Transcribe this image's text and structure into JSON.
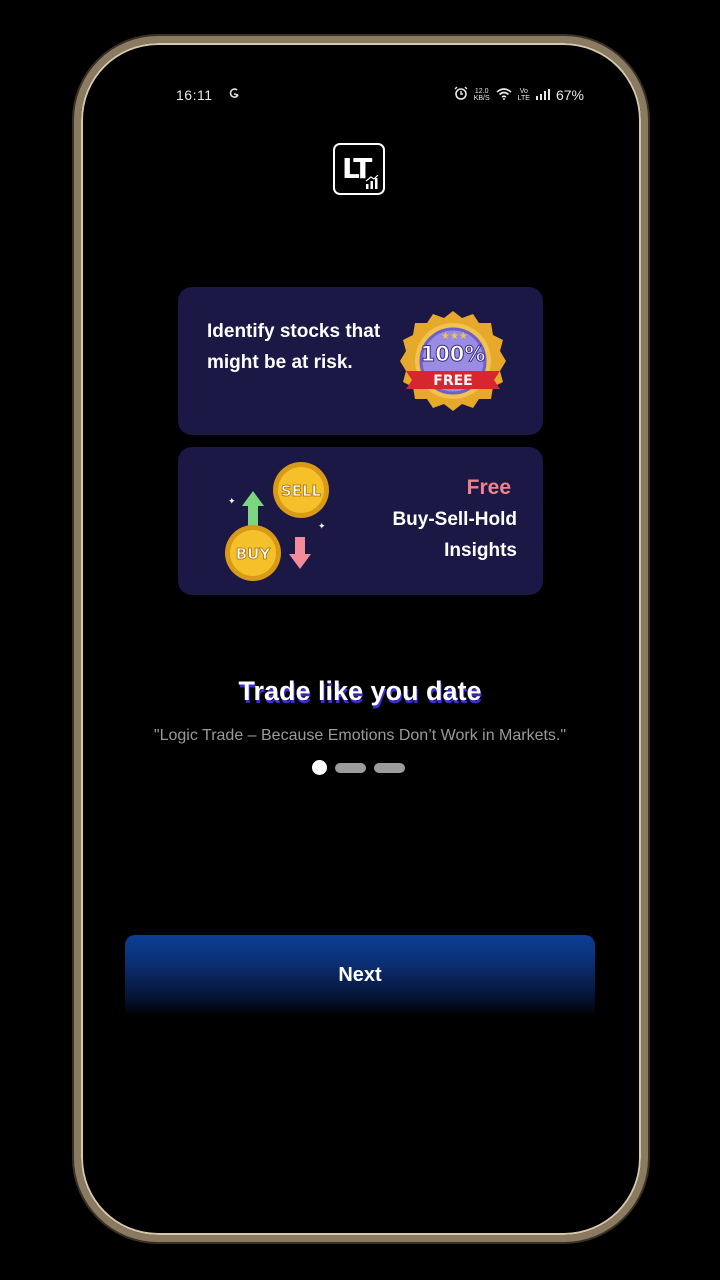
{
  "status_bar": {
    "time": "16:11",
    "net_speed_value": "12.0",
    "net_speed_unit": "KB/S",
    "network_label_top": "Vo",
    "network_label_bottom": "LTE",
    "battery": "67%"
  },
  "logo": {
    "text": "LT"
  },
  "cards": {
    "card1": {
      "text": "Identify stocks that might be at risk.",
      "badge_percent": "100%",
      "badge_label": "FREE"
    },
    "card2": {
      "free_label": "Free",
      "line1": "Buy-Sell-Hold",
      "line2": "Insights",
      "coin_sell": "SELL",
      "coin_buy": "BUY"
    }
  },
  "headline": "Trade like you date",
  "subtitle": "\"Logic Trade – Because Emotions Don’t Work in Markets.\"",
  "pagination": {
    "active_index": 0,
    "count": 3
  },
  "next_button": {
    "label": "Next"
  },
  "colors": {
    "card_bg": "#1b1846",
    "free_accent": "#f0828a",
    "button_blue": "#0b3e96",
    "headline_shadow": "#3a2cd6"
  }
}
